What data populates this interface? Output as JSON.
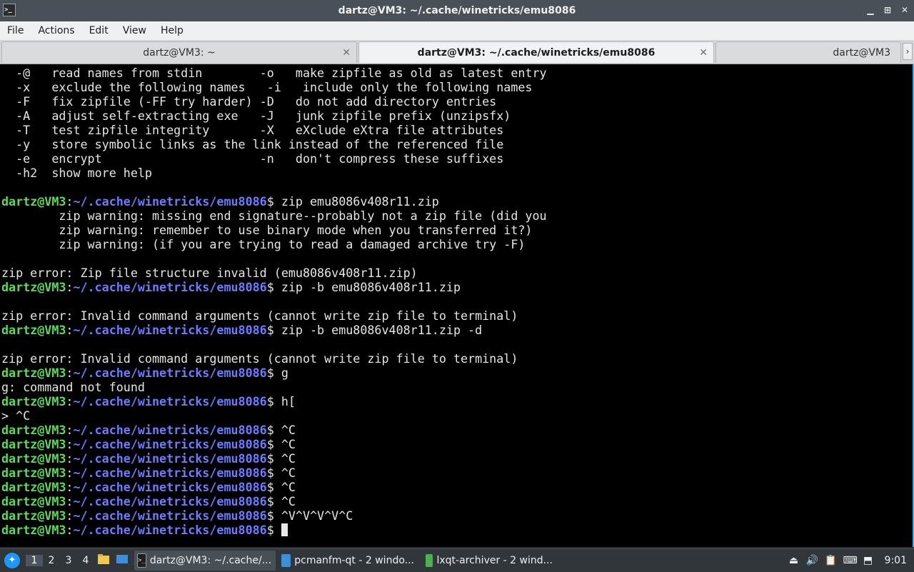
{
  "window": {
    "title": "dartz@VM3: ~/.cache/winetricks/emu8086",
    "app_icon_glyph": ">_",
    "controls": {
      "minimize": "▁",
      "maximize": "⊞",
      "close": "✕"
    }
  },
  "menu": [
    "File",
    "Actions",
    "Edit",
    "View",
    "Help"
  ],
  "tabs": [
    {
      "label": "dartz@VM3: ~",
      "active": false,
      "close": "✕"
    },
    {
      "label": "dartz@VM3: ~/.cache/winetricks/emu8086",
      "active": true,
      "close": "✕"
    },
    {
      "label": "dartz@VM3",
      "active": false
    }
  ],
  "tab_scroll": "›",
  "prompt": {
    "user": "dartz@VM3",
    "sep": ":",
    "path": "~/.cache/winetricks/emu8086",
    "symbol": "$ "
  },
  "colors": {
    "prompt_user": "#5fd75f",
    "prompt_path": "#6e7bff",
    "terminal_bg": "#000000",
    "text": "#e6e6e6",
    "accent": "#3daee9"
  },
  "terminal_lines": [
    {
      "t": "out",
      "text": "  -@   read names from stdin        -o   make zipfile as old as latest entry"
    },
    {
      "t": "out",
      "text": "  -x   exclude the following names   -i   include only the following names"
    },
    {
      "t": "out",
      "text": "  -F   fix zipfile (-FF try harder) -D   do not add directory entries"
    },
    {
      "t": "out",
      "text": "  -A   adjust self-extracting exe   -J   junk zipfile prefix (unzipsfx)"
    },
    {
      "t": "out",
      "text": "  -T   test zipfile integrity       -X   eXclude eXtra file attributes"
    },
    {
      "t": "out",
      "text": "  -y   store symbolic links as the link instead of the referenced file"
    },
    {
      "t": "out",
      "text": "  -e   encrypt                      -n   don't compress these suffixes"
    },
    {
      "t": "out",
      "text": "  -h2  show more help"
    },
    {
      "t": "out",
      "text": ""
    },
    {
      "t": "cmd",
      "text": "zip emu8086v408r11.zip"
    },
    {
      "t": "out",
      "text": "        zip warning: missing end signature--probably not a zip file (did you"
    },
    {
      "t": "out",
      "text": "        zip warning: remember to use binary mode when you transferred it?)"
    },
    {
      "t": "out",
      "text": "        zip warning: (if you are trying to read a damaged archive try -F)"
    },
    {
      "t": "out",
      "text": ""
    },
    {
      "t": "out",
      "text": "zip error: Zip file structure invalid (emu8086v408r11.zip)"
    },
    {
      "t": "cmd",
      "text": "zip -b emu8086v408r11.zip"
    },
    {
      "t": "out",
      "text": ""
    },
    {
      "t": "out",
      "text": "zip error: Invalid command arguments (cannot write zip file to terminal)"
    },
    {
      "t": "cmd",
      "text": "zip -b emu8086v408r11.zip -d"
    },
    {
      "t": "out",
      "text": ""
    },
    {
      "t": "out",
      "text": "zip error: Invalid command arguments (cannot write zip file to terminal)"
    },
    {
      "t": "cmd",
      "text": "g"
    },
    {
      "t": "out",
      "text": "g: command not found"
    },
    {
      "t": "cmd",
      "text": "h["
    },
    {
      "t": "out",
      "text": "> ^C"
    },
    {
      "t": "cmd",
      "text": "^C"
    },
    {
      "t": "cmd",
      "text": "^C"
    },
    {
      "t": "cmd",
      "text": "^C"
    },
    {
      "t": "cmd",
      "text": "^C"
    },
    {
      "t": "cmd",
      "text": "^C"
    },
    {
      "t": "cmd",
      "text": "^C"
    },
    {
      "t": "cmd",
      "text": "^V^V^V^V^C"
    },
    {
      "t": "cmd",
      "text": "",
      "cursor": true
    }
  ],
  "taskbar": {
    "start_glyph": "✦",
    "desktops": [
      "1",
      "2",
      "3",
      "4"
    ],
    "quicklaunch": [
      "file-manager-icon",
      "show-desktop-icon"
    ],
    "tasks": [
      {
        "label": "dartz@VM3: ~/.cache/...",
        "icon": "terminal-icon",
        "active": true
      },
      {
        "label": "pcmanfm-qt - 2 windo...",
        "icon": "folder-icon",
        "active": false
      },
      {
        "label": "lxqt-archiver - 2 wind...",
        "icon": "archive-icon",
        "active": false
      }
    ],
    "clock": "9:01"
  }
}
